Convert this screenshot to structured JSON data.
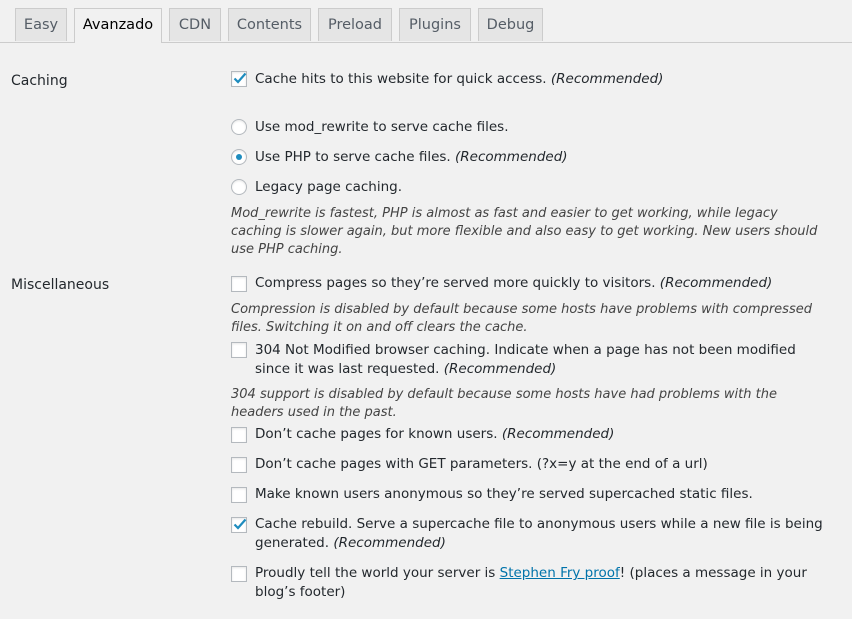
{
  "tabs": [
    {
      "label": "Easy"
    },
    {
      "label": "Avanzado"
    },
    {
      "label": "CDN"
    },
    {
      "label": "Contents"
    },
    {
      "label": "Preload"
    },
    {
      "label": "Plugins"
    },
    {
      "label": "Debug"
    }
  ],
  "active_tab": "Avanzado",
  "caching": {
    "label": "Caching",
    "cache_hits": {
      "text": "Cache hits to this website for quick access.",
      "note": "(Recommended)",
      "checked": true
    },
    "modes": [
      {
        "text": "Use mod_rewrite to serve cache files.",
        "note": "",
        "selected": false
      },
      {
        "text": "Use PHP to serve cache files.",
        "note": "(Recommended)",
        "selected": true
      },
      {
        "text": "Legacy page caching.",
        "note": "",
        "selected": false
      }
    ],
    "description": "Mod_rewrite is fastest, PHP is almost as fast and easier to get working, while legacy caching is slower again, but more flexible and also easy to get working. New users should use PHP caching."
  },
  "misc": {
    "label": "Miscellaneous",
    "compress": {
      "text": "Compress pages so they’re served more quickly to visitors.",
      "note": "(Recommended)",
      "checked": false
    },
    "compress_desc": "Compression is disabled by default because some hosts have problems with compressed files. Switching it on and off clears the cache.",
    "not_modified": {
      "text": "304 Not Modified browser caching. Indicate when a page has not been modified since it was last requested.",
      "note": "(Recommended)",
      "checked": false
    },
    "not_modified_desc": "304 support is disabled by default because some hosts have had problems with the headers used in the past.",
    "known_users": {
      "text": "Don’t cache pages for known users.",
      "note": "(Recommended)",
      "checked": false
    },
    "get_params": {
      "text": "Don’t cache pages with GET parameters. (?x=y at the end of a url)",
      "note": "",
      "checked": false
    },
    "anonymous": {
      "text": "Make known users anonymous so they’re served supercached static files.",
      "note": "",
      "checked": false
    },
    "rebuild": {
      "text": "Cache rebuild. Serve a supercache file to anonymous users while a new file is being generated.",
      "note": "(Recommended)",
      "checked": true
    },
    "proud": {
      "prefix": "Proudly tell the world your server is ",
      "link": "Stephen Fry proof",
      "suffix": "! (places a message in your blog’s footer)",
      "checked": false
    }
  },
  "colors": {
    "accent": "#1e8cbe",
    "link": "#0073aa"
  }
}
